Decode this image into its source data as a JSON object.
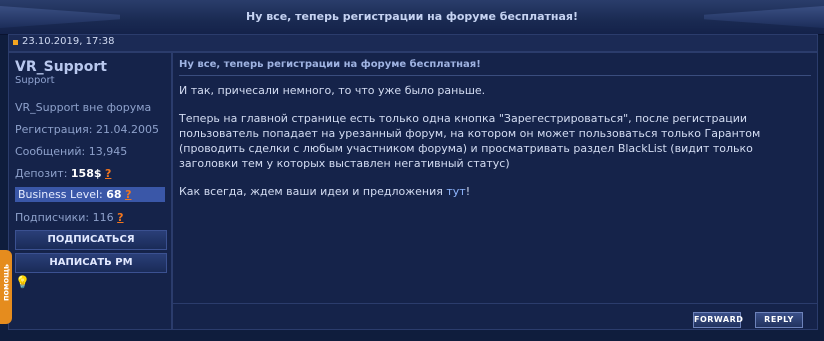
{
  "thread": {
    "title": "Ну все, теперь регистрации на форуме бесплатная!"
  },
  "post": {
    "date": "23.10.2019, 17:38",
    "title": "Ну все, теперь регистрации на форуме бесплатная!",
    "paragraphs": [
      "И так, причесали немного, то что уже было раньше.",
      "Теперь на главной странице есть только одна кнопка \"Зарегестрироваться\", после регистрации пользователь попадает на урезанный форум, на котором он может пользоваться только Гарантом (проводить сделки с любым участником форума) и просматривать раздел BlackList (видит только заголовки тем у которых выставлен негативный статус)"
    ],
    "closing_text": "Как всегда, ждем ваши идеи и предложения",
    "closing_link": "тут",
    "closing_mark": "!",
    "forward_label": "FORWARD",
    "reply_label": "REPLY"
  },
  "user": {
    "name": "VR_Support",
    "role": "Support",
    "status": "VR_Support вне форума",
    "registration": "Регистрация: 21.04.2005",
    "messages": "Сообщений: 13,945",
    "deposit_label": "Депозит:",
    "deposit_value": "158$",
    "business_label": "Business Level:",
    "business_value": "68",
    "subscribers_label": "Подписчики:",
    "subscribers_value": "116",
    "help_mark": "?",
    "subscribe_button": "ПОДПИСАТЬСЯ",
    "pm_button": "НАПИСАТЬ PM"
  },
  "side_tab": {
    "label": "помощь"
  },
  "colors": {
    "accent_orange": "#f2761e",
    "business_bg": "#3a57a8",
    "panel_bg": "#15234a"
  }
}
